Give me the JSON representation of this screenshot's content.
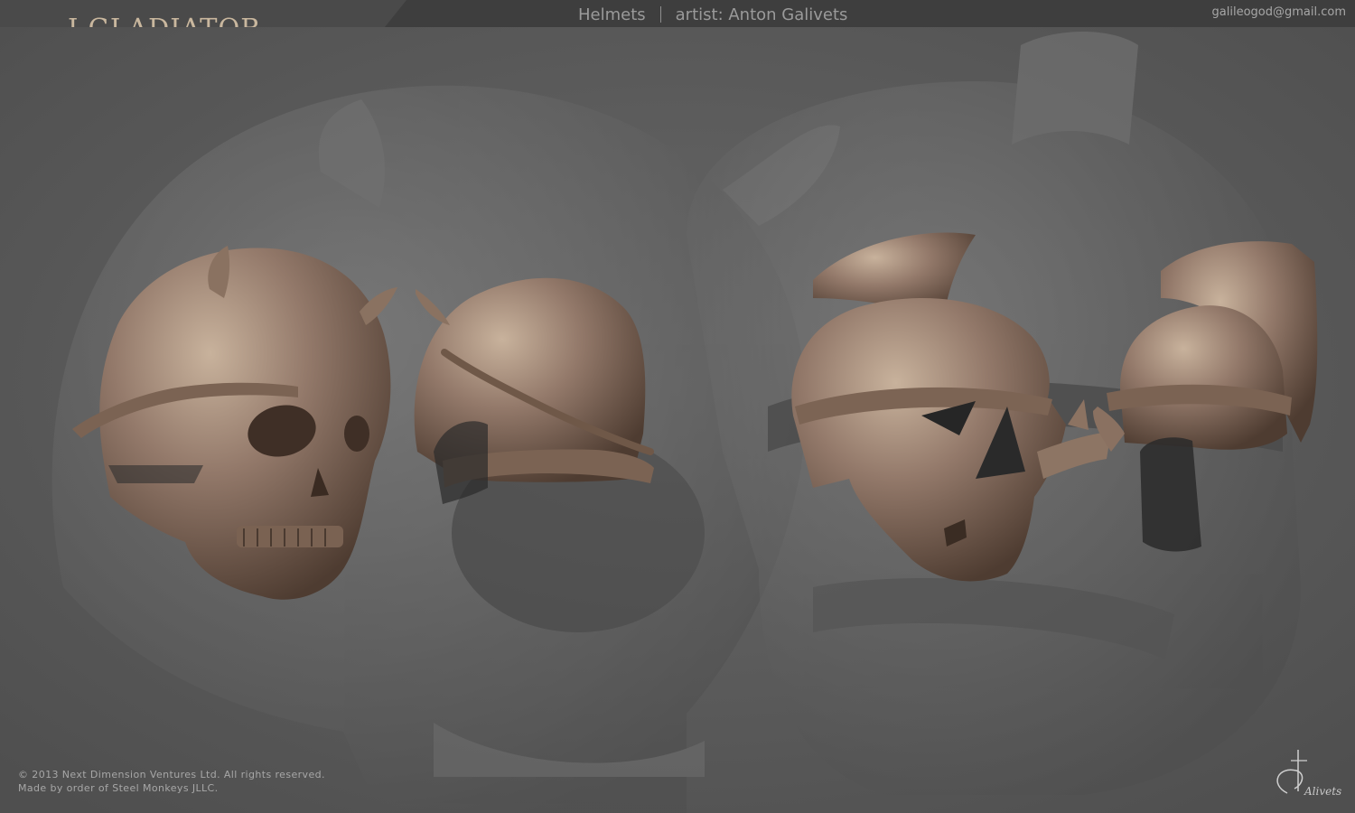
{
  "header": {
    "brand": "I.GLADIATOR",
    "category": "Helmets",
    "artist": "artist: Anton Galivets",
    "email": "galileogod@gmail.com"
  },
  "footer": {
    "copyright": "© 2013 Next Dimension Ventures Ltd. All rights reserved.",
    "credit": "Made by order of Steel Monkeys JLLC."
  },
  "signature": {
    "text": "Alivets"
  },
  "colors": {
    "background": "#5b5b5b",
    "header_bar": "#3e3e3e",
    "helmet_clay": "#8c7461",
    "brand_text": "#c9b79e",
    "muted_text": "#a7a7a7"
  },
  "scene": {
    "background_icons": [
      "large-skull-silhouette-icon",
      "large-gladiator-helmet-silhouette-icon"
    ],
    "models": [
      "skull-helmet-front-icon",
      "skull-helmet-back-icon",
      "gladiator-helmet-front-icon",
      "gladiator-helmet-side-icon"
    ]
  }
}
